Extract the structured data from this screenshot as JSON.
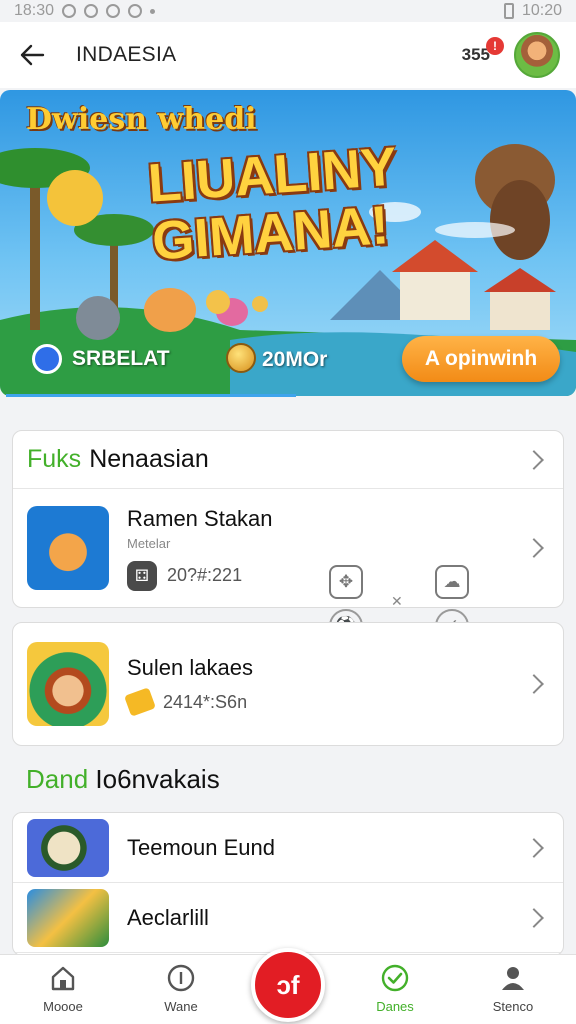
{
  "status_bar": {
    "time_left": "18:30",
    "time_right": "10:20"
  },
  "app_bar": {
    "title": "INDAESIA",
    "counter": "355",
    "badge": "!"
  },
  "banner": {
    "brand": "Dwiesn whedi",
    "headline_line1": "LIUALINY",
    "headline_line2": "GIMANA!",
    "left_label": "SRBELAT",
    "amount": "20MOr",
    "cta": "A opinwinh"
  },
  "section1": {
    "header_green": "Fuks",
    "header_rest": "Nenaasian",
    "rows": [
      {
        "title": "Ramen Stakan",
        "subtitle": "Metelar",
        "meta": "20?#:221",
        "badge": "B"
      },
      {
        "title": "Sulen lakaes",
        "meta": "2414*:S6n"
      }
    ]
  },
  "section2": {
    "title_green": "Dand",
    "title_rest": "Io6nvakais",
    "rows": [
      {
        "title": "Teemoun Eund"
      },
      {
        "title": "Aeclarlill"
      }
    ]
  },
  "bottom_nav": {
    "items": [
      {
        "label": "Moooe"
      },
      {
        "label": "Wane"
      },
      {
        "label": "Danes"
      },
      {
        "label": "Stenco"
      }
    ],
    "center_label": "ɔf"
  },
  "colors": {
    "accent_green": "#43b02a",
    "center_red": "#e21d24",
    "cta_orange": "#f28b16",
    "sky_blue": "#2f97e2"
  }
}
